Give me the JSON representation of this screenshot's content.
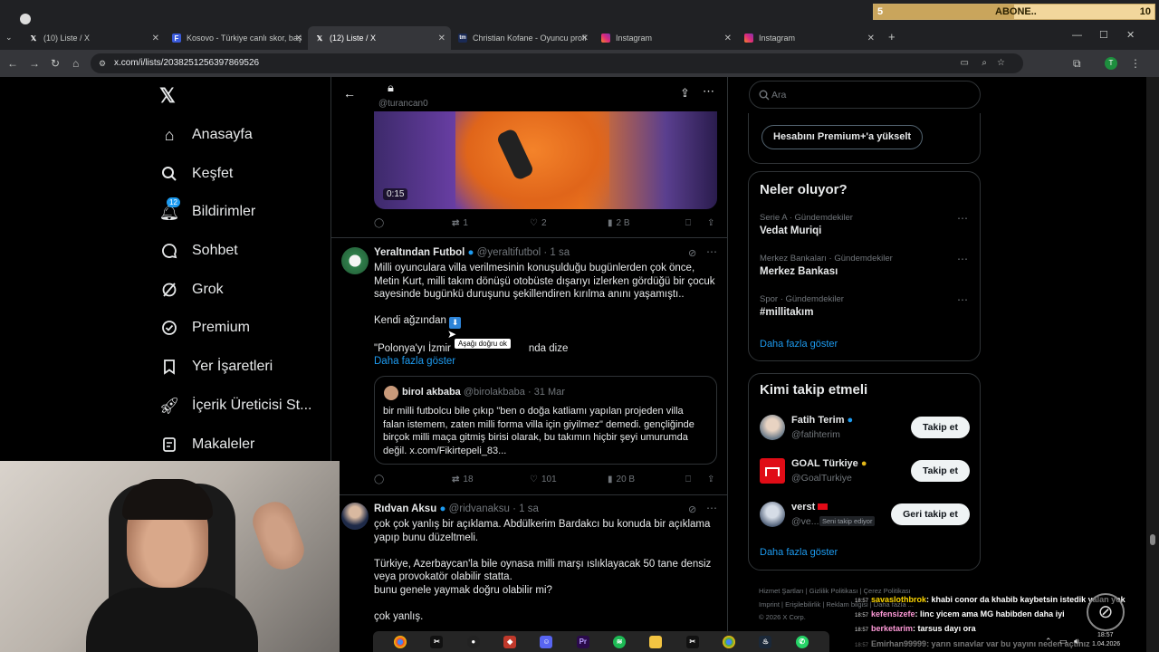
{
  "browser": {
    "tabs": [
      {
        "title": "(10) Liste / X",
        "favicon": "x-logo"
      },
      {
        "title": "Kosovo - Türkiye canlı skor, baş",
        "favicon": "flash-logo"
      },
      {
        "title": "(12) Liste / X",
        "favicon": "x-logo",
        "active": true
      },
      {
        "title": "Christian Kofane - Oyuncu profi",
        "favicon": "tm-logo"
      },
      {
        "title": "Instagram",
        "favicon": "instagram-logo"
      },
      {
        "title": "Instagram",
        "favicon": "instagram-logo"
      }
    ],
    "new_tab": "+",
    "url": "x.com/i/lists/2038251256397869526"
  },
  "sub_goal": {
    "current": "5",
    "label": "ABONE..",
    "target": "10",
    "progress": 0.5
  },
  "nav": {
    "items": [
      {
        "label": "Anasayfa",
        "icon": "home-icon"
      },
      {
        "label": "Keşfet",
        "icon": "search-icon"
      },
      {
        "label": "Bildirimler",
        "icon": "bell-icon",
        "badge": "12"
      },
      {
        "label": "Sohbet",
        "icon": "chat-icon"
      },
      {
        "label": "Grok",
        "icon": "grok-icon"
      },
      {
        "label": "Premium",
        "icon": "premium-icon"
      },
      {
        "label": "Yer İşaretleri",
        "icon": "bookmark-icon"
      },
      {
        "label": "İçerik Üreticisi St...",
        "icon": "rocket-icon"
      },
      {
        "label": "Makaleler",
        "icon": "article-icon"
      }
    ]
  },
  "list_header": {
    "handle": "@turancan0"
  },
  "video_post": {
    "duration": "0:15",
    "replies": "",
    "reposts": "1",
    "likes": "2",
    "views": "2 B"
  },
  "post1": {
    "author": "Yeraltından Futbol",
    "handle": "@yeraltifutbol",
    "time": "1 sa",
    "text_lines": [
      "Milli oyunculara villa verilmesinin konuşulduğu bugünlerden çok önce,",
      "Metin Kurt, milli takım dönüşü otobüste dışarıyı izlerken gördüğü bir çocuk",
      "sayesinde bugünkü duruşunu şekillendiren kırılma anını yaşamıştı.."
    ],
    "line2": "Kendi ağzından",
    "line3_a": "\"Polonya'yı İzmir",
    "line3_b": "nda dize",
    "show_more": "Daha fazla göster",
    "tooltip": "Aşağı doğru ok",
    "quote": {
      "author": "birol akbaba",
      "handle": "@birolakbaba",
      "date": "31 Mar",
      "text_lines": [
        "bir milli futbolcu bile çıkıp \"ben o doğa katliamı yapılan projeden villa",
        "falan istemem, zaten milli forma villa için giyilmez\" demedi. gençliğinde",
        "birçok milli maça gitmiş birisi olarak, bu takımın hiçbir şeyi umurumda",
        "değil. x.com/Fikirtepeli_83..."
      ]
    },
    "reposts": "18",
    "likes": "101",
    "views": "20 B"
  },
  "post2": {
    "author": "Rıdvan Aksu",
    "handle": "@ridvanaksu",
    "time": "1 sa",
    "text_lines": [
      "çok çok yanlış bir açıklama. Abdülkerim Bardakcı bu konuda bir açıklama",
      "yapıp bunu düzeltmeli.",
      "",
      "Türkiye, Azerbaycan'la bile oynasa milli marşı ıslıklayacak 50 tane densiz",
      "veya provokatör olabilir statta.",
      "bunu genele yaymak doğru olabilir mi?",
      "",
      "çok yanlış."
    ]
  },
  "right": {
    "search_placeholder": "Ara",
    "premium_btn": "Hesabını Premium+'a yükselt",
    "trends_title": "Neler oluyor?",
    "trends": [
      {
        "meta": "Serie A · Gündemdekiler",
        "name": "Vedat Muriqi"
      },
      {
        "meta": "Merkez Bankaları · Gündemdekiler",
        "name": "Merkez Bankası"
      },
      {
        "meta": "Spor · Gündemdekiler",
        "name": "#millitakım"
      }
    ],
    "show_more": "Daha fazla göster",
    "who_title": "Kimi takip etmeli",
    "who": [
      {
        "name": "Fatih Terim",
        "handle": "@fatihterim",
        "button": "Takip et"
      },
      {
        "name": "GOAL Türkiye",
        "handle": "@GoalTurkiye",
        "button": "Takip et"
      },
      {
        "name": "verst",
        "handle": "@ve...",
        "tag": "Seni takip ediyor",
        "button": "Geri takip et"
      }
    ],
    "who_more": "Daha fazla göster",
    "footer": [
      "Hizmet Şartları",
      "Gizlilik Politikası",
      "Çerez Politikası",
      "Imprint",
      "Erişilebilirlik",
      "Reklam bilgisi",
      "Daha fazla ...",
      "© 2026 X Corp."
    ]
  },
  "chat": [
    {
      "ts": "18:57",
      "user": "savaslothbrok",
      "msg": ": khabi conor da khabib kaybetsin istedik yalan yok",
      "color": "#ffd700"
    },
    {
      "ts": "18:57",
      "user": "kefensizefe",
      "msg": ": linc yicem ama MG habibden daha iyi",
      "color": "#ff9ad8"
    },
    {
      "ts": "18:57",
      "user": "berketarim",
      "msg": ": tarsus dayı ora",
      "color": "#ff9ad8"
    },
    {
      "ts": "18:57",
      "user": "Emirhan99999",
      "msg": ": yarın sınavlar var bu yayını neden açtınız",
      "color": "#ffffff"
    }
  ],
  "clock": {
    "time": "18:57",
    "date": "1.04.2026"
  },
  "colors": {
    "accent": "#1d9bf0",
    "bg": "#000000",
    "border": "#2f3336",
    "muted": "#71767b"
  }
}
